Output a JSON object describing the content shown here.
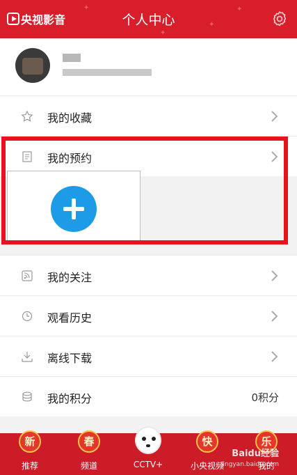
{
  "header": {
    "logo_text": "央视影音",
    "title": "个人中心",
    "settings_icon": "gear-icon",
    "background": "#d81e2a"
  },
  "profile": {
    "avatar_icon": "avatar"
  },
  "menu": [
    {
      "label": "我的收藏",
      "icon": "star-icon"
    },
    {
      "label": "我的预约",
      "icon": "calendar-icon"
    },
    {
      "label": "我的关注",
      "icon": "feed-icon"
    },
    {
      "label": "观看历史",
      "icon": "clock-icon"
    },
    {
      "label": "离线下载",
      "icon": "download-icon"
    },
    {
      "label": "我的积分",
      "icon": "coin-stack-icon",
      "value": "0积分"
    }
  ],
  "popup": {
    "plus_icon": "plus-icon",
    "accent": "#1e9be6",
    "highlight_color": "#e8121e"
  },
  "bottom_nav": [
    {
      "badge": "新",
      "label": "推荐"
    },
    {
      "badge": "春",
      "label": "频道"
    },
    {
      "badge": "",
      "label": "CCTV+"
    },
    {
      "badge": "快",
      "label": "小央视频"
    },
    {
      "badge": "乐",
      "label": "我的"
    }
  ],
  "watermark": {
    "text": "Baidu经验",
    "url": "jingyan.baidu.com"
  }
}
